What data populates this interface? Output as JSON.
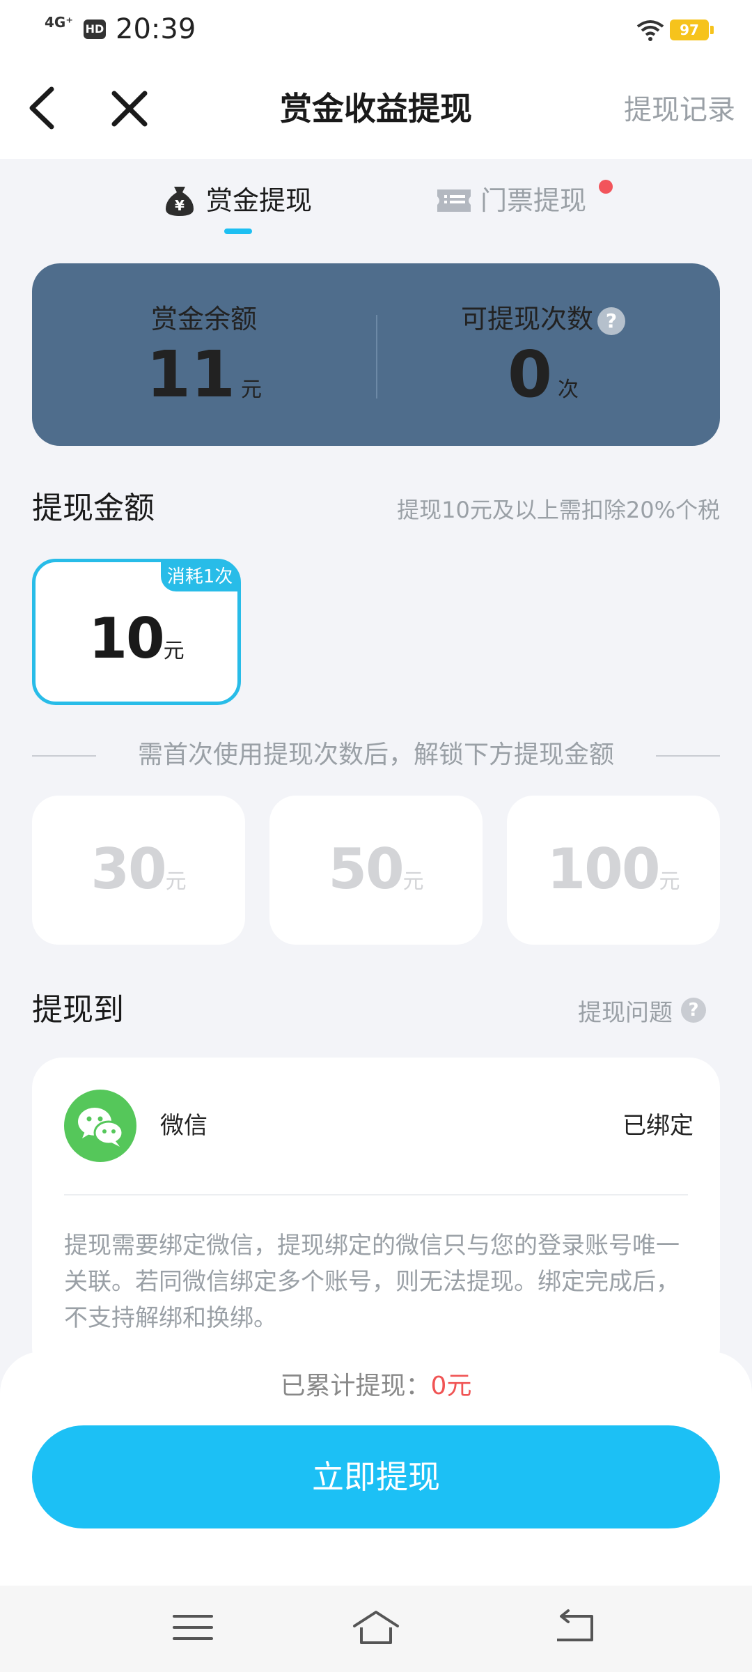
{
  "status_bar": {
    "network": "4G⁺",
    "hd": "HD",
    "time": "20:39",
    "battery": "97"
  },
  "nav": {
    "title": "赏金收益提现",
    "record_link": "提现记录"
  },
  "tabs": [
    {
      "label": "赏金提现",
      "active": true
    },
    {
      "label": "门票提现",
      "active": false,
      "has_dot": true
    }
  ],
  "balance_card": {
    "balance_label": "赏金余额",
    "balance_value": "11",
    "balance_unit": "元",
    "count_label": "可提现次数",
    "count_value": "0",
    "count_unit": "次"
  },
  "amount_section": {
    "title": "提现金额",
    "tax_note": "提现10元及以上需扣除20%个税",
    "selected": {
      "badge": "消耗1次",
      "value": "10",
      "unit": "元"
    },
    "unlock_hint": "需首次使用提现次数后，解锁下方提现金额",
    "locked": [
      {
        "value": "30",
        "unit": "元"
      },
      {
        "value": "50",
        "unit": "元"
      },
      {
        "value": "100",
        "unit": "元"
      }
    ]
  },
  "withdraw_to": {
    "title": "提现到",
    "issue_link": "提现问题",
    "method_name": "微信",
    "method_status": "已绑定",
    "description": "提现需要绑定微信，提现绑定的微信只与您的登录账号唯一关联。若同微信绑定多个账号，则无法提现。绑定完成后，不支持解绑和换绑。"
  },
  "footer": {
    "cumulative_label": "已累计提现：",
    "cumulative_value": "0元",
    "cta_label": "立即提现"
  },
  "colors": {
    "accent": "#1cc0f5",
    "card": "#4f6d8c",
    "wechat": "#55c75a",
    "alert": "#f05454"
  }
}
